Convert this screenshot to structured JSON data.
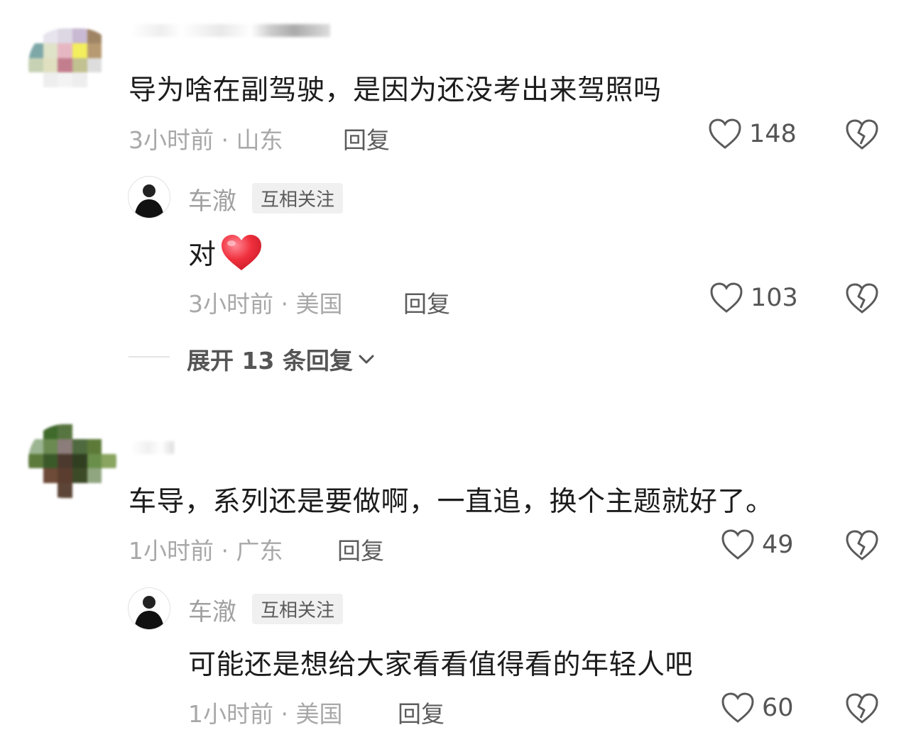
{
  "comments": [
    {
      "text": "导为啥在副驾驶，是因为还没考出来驾照吗",
      "meta": "3小时前 · 山东",
      "reply_label": "回复",
      "likes": "148",
      "reply": {
        "author": "车澈",
        "badge": "互相关注",
        "text": "对",
        "meta": "3小时前 · 美国",
        "reply_label": "回复",
        "likes": "103"
      },
      "expand_label": "展开 13 条回复"
    },
    {
      "text": "车导，系列还是要做啊，一直追，换个主题就好了。",
      "meta": "1小时前 · 广东",
      "reply_label": "回复",
      "likes": "49",
      "reply": {
        "author": "车澈",
        "badge": "互相关注",
        "text": "可能还是想给大家看看值得看的年轻人吧",
        "meta": "1小时前 · 美国",
        "reply_label": "回复",
        "likes": "60"
      }
    }
  ],
  "icons": {
    "like": "heart-outline-icon",
    "dislike": "broken-heart-icon",
    "emoji": "red-heart-emoji",
    "chevron": "chevron-down-icon"
  },
  "colors": {
    "text": "#1c1c1c",
    "meta": "#a8a8a8",
    "heart_emoji": "#f0303d"
  }
}
